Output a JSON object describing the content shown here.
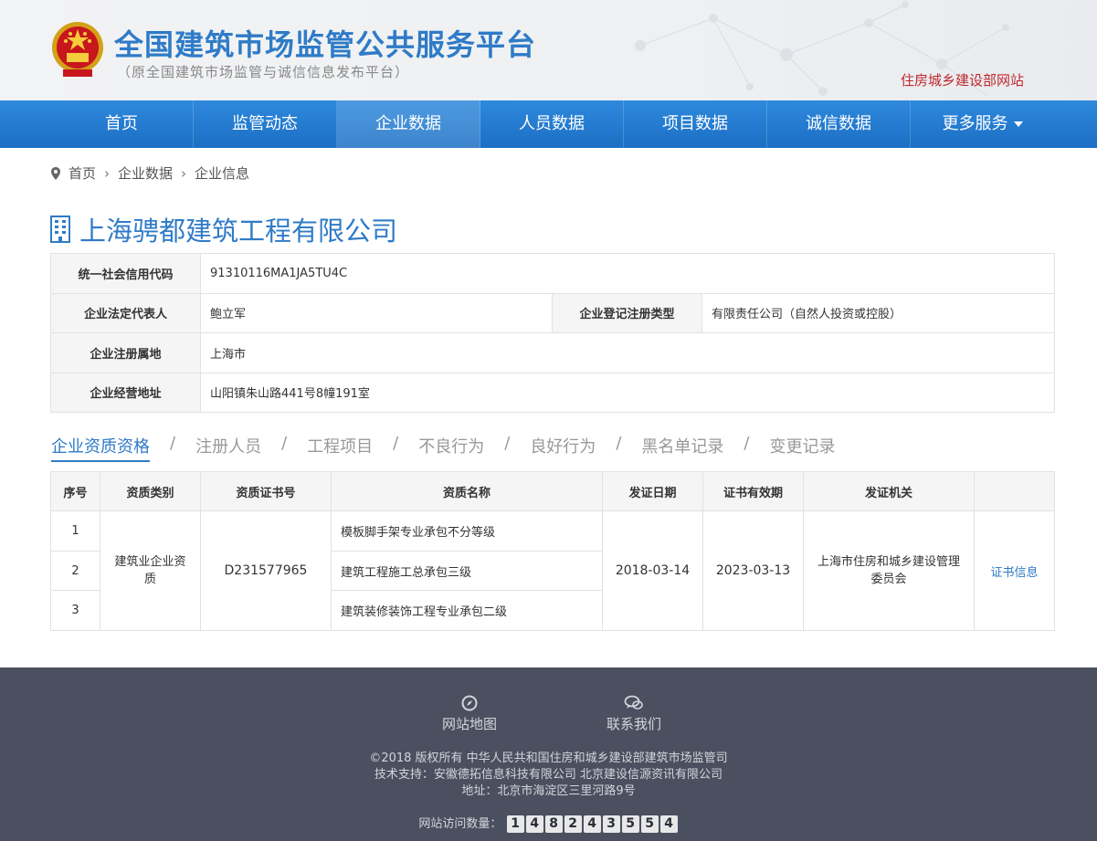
{
  "header": {
    "title": "全国建筑市场监管公共服务平台",
    "subtitle": "（原全国建筑市场监管与诚信信息发布平台）",
    "ministry_link": "住房城乡建设部网站"
  },
  "nav": {
    "items": [
      {
        "label": "首页"
      },
      {
        "label": "监管动态"
      },
      {
        "label": "企业数据"
      },
      {
        "label": "人员数据"
      },
      {
        "label": "项目数据"
      },
      {
        "label": "诚信数据"
      },
      {
        "label": "更多服务"
      }
    ]
  },
  "breadcrumb": {
    "home": "首页",
    "level1": "企业数据",
    "level2": "企业信息"
  },
  "company": {
    "name": "上海骋都建筑工程有限公司",
    "credit_code_label": "统一社会信用代码",
    "credit_code": "91310116MA1JA5TU4C",
    "legal_rep_label": "企业法定代表人",
    "legal_rep": "鲍立军",
    "reg_type_label": "企业登记注册类型",
    "reg_type": "有限责任公司（自然人投资或控股）",
    "reg_place_label": "企业注册属地",
    "reg_place": "上海市",
    "address_label": "企业经营地址",
    "address": "山阳镇朱山路441号8幢191室"
  },
  "tabs": [
    "企业资质资格",
    "注册人员",
    "工程项目",
    "不良行为",
    "良好行为",
    "黑名单记录",
    "变更记录"
  ],
  "qual_table": {
    "headers": [
      "序号",
      "资质类别",
      "资质证书号",
      "资质名称",
      "发证日期",
      "证书有效期",
      "发证机关",
      ""
    ],
    "category": "建筑业企业资质",
    "cert_no": "D231577965",
    "issue_date": "2018-03-14",
    "valid_until": "2023-03-13",
    "authority": "上海市住房和城乡建设管理委员会",
    "action": "证书信息",
    "rows": [
      {
        "no": "1",
        "name": "模板脚手架专业承包不分等级"
      },
      {
        "no": "2",
        "name": "建筑工程施工总承包三级"
      },
      {
        "no": "3",
        "name": "建筑装修装饰工程专业承包二级"
      }
    ]
  },
  "footer": {
    "sitemap": "网站地图",
    "contact": "联系我们",
    "copyright": "©2018 版权所有 中华人民共和国住房和城乡建设部建筑市场监管司",
    "tech": "技术支持：安徽德拓信息科技有限公司  北京建设信源资讯有限公司",
    "address": "地址：北京市海淀区三里河路9号",
    "visits_label": "网站访问数量：",
    "visits_digits": [
      "1",
      "4",
      "8",
      "2",
      "4",
      "3",
      "5",
      "5",
      "4"
    ]
  },
  "colors": {
    "brand_blue": "#2f7bc7",
    "nav_blue": "#1c6fc4",
    "footer_bg": "#4b5060",
    "ministry_red": "#c0272d"
  }
}
